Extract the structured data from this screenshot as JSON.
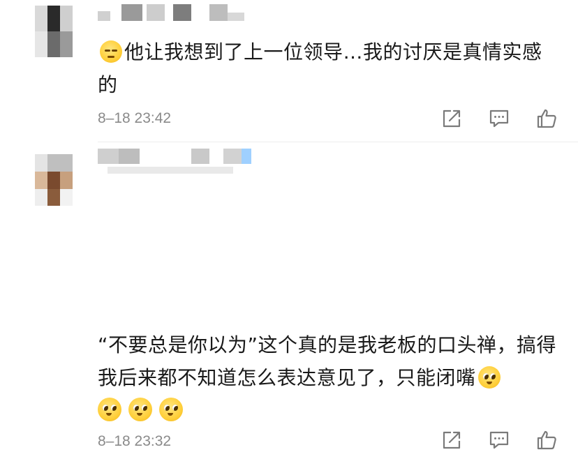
{
  "comments": [
    {
      "text": "他让我想到了上一位领导…我的讨厌是真情实感的",
      "timestamp": "8–18 23:42",
      "leading_emoji": "shy-face",
      "actions": [
        "share-icon",
        "reply-icon",
        "like-icon"
      ]
    },
    {
      "text": "“不要总是你以为”这个真的是我老板的口头禅，搞得我后来都不知道怎么表达意见了，只能闭嘴",
      "trailing_emoji": "pleading-face",
      "extra_emojis": [
        "pleading-face",
        "pleading-face",
        "pleading-face"
      ],
      "timestamp": "8–18 23:32",
      "actions": [
        "share-icon",
        "reply-icon",
        "like-icon"
      ]
    }
  ],
  "colors": {
    "text": "#1a1a1a",
    "meta": "#8a8a8a",
    "icon": "#7a7a7a",
    "divider": "#ececec",
    "badge_blue": "#9fd0ff"
  }
}
